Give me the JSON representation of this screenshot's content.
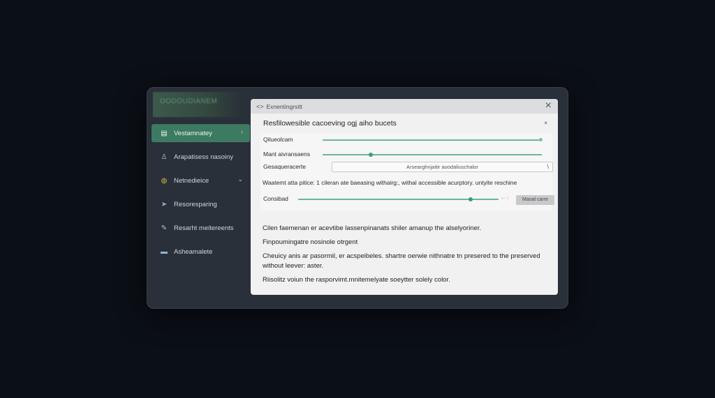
{
  "app": {
    "title": "OODOUDIANEM"
  },
  "sidebar": {
    "items": [
      {
        "label": "Vestamnatey",
        "icon": "list-icon",
        "active": true
      },
      {
        "label": "Arapatisess nasoiny",
        "icon": "person-icon",
        "active": false
      },
      {
        "label": "Netnedieice",
        "icon": "palette-icon",
        "active": false,
        "trail": "⌄"
      },
      {
        "label": "Resoresparing",
        "icon": "arrow-icon",
        "active": false
      },
      {
        "label": "Resarht meitereents",
        "icon": "pen-icon",
        "active": false
      },
      {
        "label": "Asheamalete",
        "icon": "folder-icon",
        "active": false
      }
    ],
    "active_trail": "›"
  },
  "dialog": {
    "header": "Exnentingrsitt",
    "back_glyph": "<>",
    "close_glyph": "×",
    "subtitle": "Resfilowesible cacoeving ogj aiho bucets",
    "mini_close": "×",
    "rows": {
      "r1_label": "Qilueolcam",
      "r2_label": "Mant aivransaens",
      "r3_label": "Gesaqueracerte",
      "select_value": "Arsearghnjaitir aoodaliuschalor",
      "select_caret": "\\",
      "hint": "Waatemt atta pitice: 1 cileran ate baeasing withairg:, withal accessible acurptory. untyite reschine",
      "r5_label": "Consibad",
      "apply_label": "Maoal carre",
      "arrow_tail": "←·:"
    },
    "slider_levels": {
      "r1": 1.0,
      "r2": 0.22,
      "r3": 1.0,
      "r5": 0.86
    },
    "paragraphs": [
      "Cilen faemenan er acevtibe lassenpinanats shiler amanup the alselyoriner.",
      "Finpoumingatre nosinole otrgent",
      "Cheuicy anis ar pasormil, er acspeibeles. shartre oerwie nithnatre tn presered to the preserved without leever: aster.",
      "Riisolitz voiun the rasporvimt.mnitemelyate soeytter solely color."
    ]
  },
  "colors": {
    "accent": "#3d7a62",
    "slider": "#6fb59a",
    "background": "#0b0f16"
  }
}
